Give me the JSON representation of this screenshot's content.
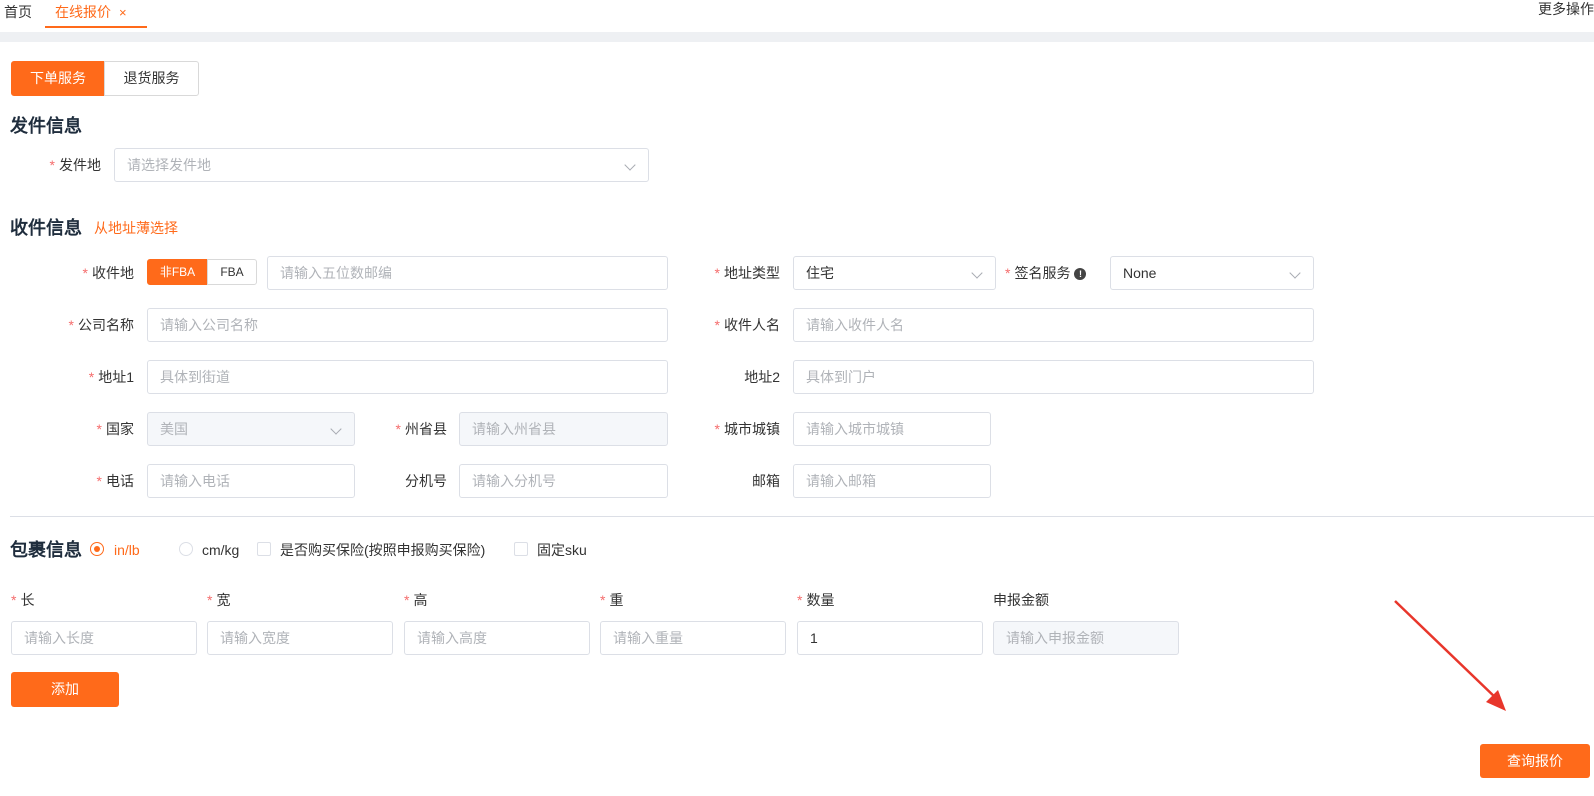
{
  "tabs": {
    "home": "首页",
    "active": "在线报价",
    "close_symbol": "×",
    "more_ops": "更多操作"
  },
  "service_toggle": {
    "order": "下单服务",
    "return": "退货服务"
  },
  "sender": {
    "title": "发件信息",
    "origin_label": "发件地",
    "origin_placeholder": "请选择发件地"
  },
  "receiver": {
    "title": "收件信息",
    "address_book_link": "从地址薄选择",
    "dest_label": "收件地",
    "non_fba": "非FBA",
    "fba": "FBA",
    "zip_placeholder": "请输入五位数邮编",
    "address_type_label": "地址类型",
    "address_type_value": "住宅",
    "signature_label": "签名服务",
    "signature_value": "None",
    "company_label": "公司名称",
    "company_placeholder": "请输入公司名称",
    "recipient_label": "收件人名",
    "recipient_placeholder": "请输入收件人名",
    "address1_label": "地址1",
    "address1_placeholder": "具体到街道",
    "address2_label": "地址2",
    "address2_placeholder": "具体到门户",
    "country_label": "国家",
    "country_value": "美国",
    "state_label": "州省县",
    "state_placeholder": "请输入州省县",
    "city_label": "城市城镇",
    "city_placeholder": "请输入城市城镇",
    "phone_label": "电话",
    "phone_placeholder": "请输入电话",
    "ext_label": "分机号",
    "ext_placeholder": "请输入分机号",
    "email_label": "邮箱",
    "email_placeholder": "请输入邮箱"
  },
  "package": {
    "title": "包裹信息",
    "unit_inlb": "in/lb",
    "unit_cmkg": "cm/kg",
    "insurance": "是否购买保险(按照申报购买保险)",
    "fixed_sku": "固定sku",
    "length_label": "长",
    "length_placeholder": "请输入长度",
    "width_label": "宽",
    "width_placeholder": "请输入宽度",
    "height_label": "高",
    "height_placeholder": "请输入高度",
    "weight_label": "重",
    "weight_placeholder": "请输入重量",
    "qty_label": "数量",
    "qty_value": "1",
    "declared_label": "申报金额",
    "declared_placeholder": "请输入申报金额",
    "add_button": "添加"
  },
  "query_button": "查询报价",
  "required_mark": "*",
  "info_icon_glyph": "!",
  "colors": {
    "accent": "#ff6a1a",
    "required": "#f56c6c",
    "annotation_arrow": "#e8362b"
  }
}
